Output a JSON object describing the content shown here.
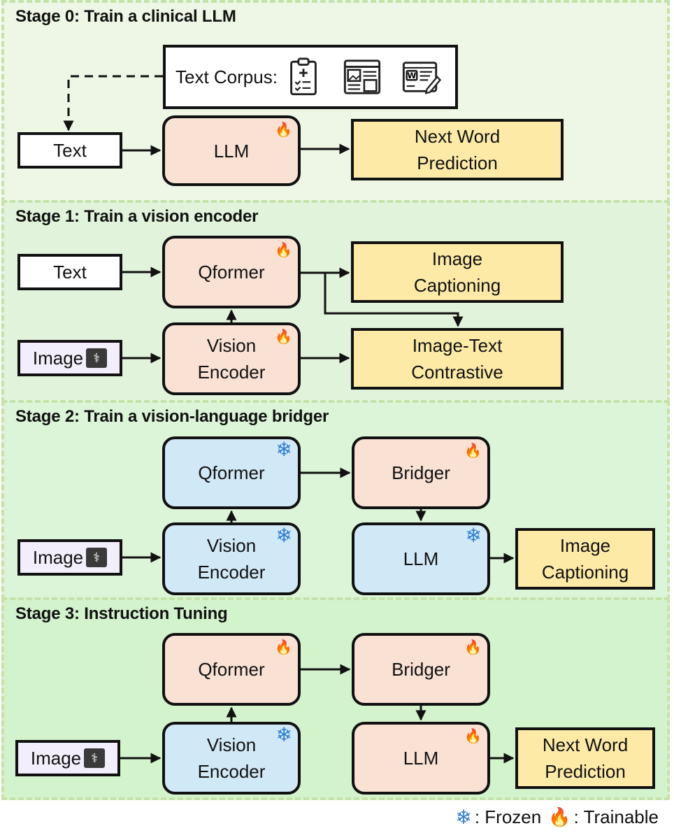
{
  "stages": [
    {
      "title": "Stage 0: Train a clinical LLM",
      "corpus_label": "Text Corpus:",
      "corpus_icons": [
        "clipboard-medical-icon",
        "webpage-images-icon",
        "word-document-edit-icon"
      ],
      "input": "Text",
      "model": {
        "label": "LLM",
        "state": "trainable"
      },
      "output": "Next Word\nPrediction"
    },
    {
      "title": "Stage 1: Train a vision encoder",
      "inputs": [
        "Text",
        "Image"
      ],
      "models": [
        {
          "label": "Qformer",
          "state": "trainable"
        },
        {
          "label": "Vision\nEncoder",
          "state": "trainable"
        }
      ],
      "outputs": [
        "Image\nCaptioning",
        "Image-Text\nContrastive"
      ]
    },
    {
      "title": "Stage 2: Train a vision-language bridger",
      "input": "Image",
      "models": [
        {
          "label": "Qformer",
          "state": "frozen"
        },
        {
          "label": "Vision\nEncoder",
          "state": "frozen"
        },
        {
          "label": "Bridger",
          "state": "trainable"
        },
        {
          "label": "LLM",
          "state": "frozen"
        }
      ],
      "output": "Image\nCaptioning"
    },
    {
      "title": "Stage 3: Instruction Tuning",
      "input": "Image",
      "models": [
        {
          "label": "Qformer",
          "state": "trainable"
        },
        {
          "label": "Vision\nEncoder",
          "state": "frozen"
        },
        {
          "label": "Bridger",
          "state": "trainable"
        },
        {
          "label": "LLM",
          "state": "trainable"
        }
      ],
      "output": "Next Word\nPrediction"
    }
  ],
  "legend": {
    "frozen_icon": "❄",
    "frozen_label": ": Frozen",
    "trainable_icon": "🔥",
    "trainable_label": ": Trainable"
  },
  "icons": {
    "snowflake": "❄",
    "fire": "🔥",
    "xray": "⚕"
  },
  "colors": {
    "trainable": "#f9e1d4",
    "frozen": "#d1e8f7",
    "objective": "#fdeaa7",
    "image_input": "#f3eefc",
    "stage_border": "#c5e2a8"
  }
}
